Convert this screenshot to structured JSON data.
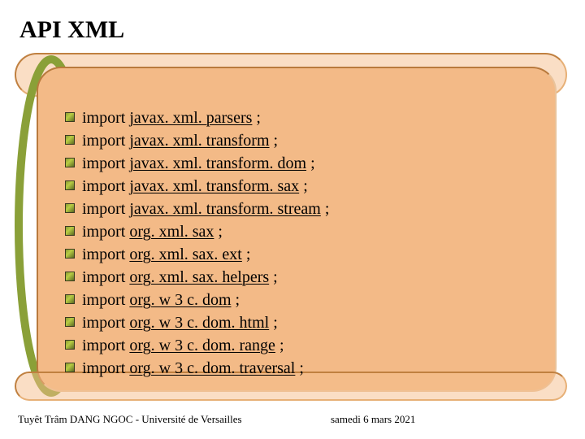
{
  "title": "API XML",
  "imports": [
    {
      "keyword": "import",
      "package": "javax. xml. parsers",
      "suffix": " ;"
    },
    {
      "keyword": "import",
      "package": "javax. xml. transform",
      "suffix": " ;"
    },
    {
      "keyword": "import",
      "package": "javax. xml. transform. dom",
      "suffix": " ;"
    },
    {
      "keyword": "import",
      "package": "javax. xml. transform. sax",
      "suffix": " ;"
    },
    {
      "keyword": "import",
      "package": "javax. xml. transform. stream",
      "suffix": " ;"
    },
    {
      "keyword": "import",
      "package": "org. xml. sax",
      "suffix": " ;"
    },
    {
      "keyword": "import",
      "package": "org. xml. sax. ext",
      "suffix": " ;"
    },
    {
      "keyword": "import",
      "package": "org. xml. sax. helpers",
      "suffix": " ;"
    },
    {
      "keyword": "import",
      "package": "org. w 3 c. dom",
      "suffix": " ;"
    },
    {
      "keyword": "import",
      "package": "org. w 3 c. dom. html",
      "suffix": " ;"
    },
    {
      "keyword": "import",
      "package": "org. w 3 c. dom. range",
      "suffix": " ;"
    },
    {
      "keyword": "import",
      "package": "org. w 3 c. dom. traversal",
      "suffix": " ;"
    }
  ],
  "footer": {
    "left": "Tuyêt Trâm DANG NGOC - Université de Versailles",
    "right": "samedi 6 mars 2021"
  }
}
